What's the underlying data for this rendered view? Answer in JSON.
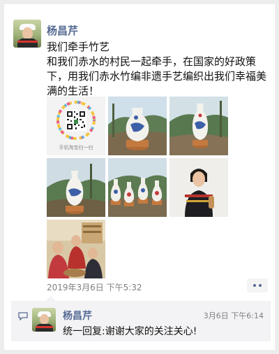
{
  "post": {
    "author": "杨昌芹",
    "text_line1": "我们牵手竹艺",
    "text_line2": "和我们赤水的村民一起牵手，在国家的好政策下，用我们赤水竹编非遗手艺编织出我们幸福美满的生活！",
    "timestamp": "2019年3月6日 下午5:32",
    "qr_caption": "手机淘宝扫一扫",
    "images": [
      "qr-code",
      "bamboo-vase",
      "bamboo-vase",
      "bamboo-vase",
      "bamboo-vase-group",
      "woman-with-vase",
      "people-working-with-bamboo"
    ]
  },
  "comments": [
    {
      "author": "杨昌芹",
      "time": "3月6日 下午6:14",
      "text": "统一回复:谢谢大家的关注关心!"
    }
  ],
  "colors": {
    "name_link": "#576b95",
    "timestamp": "#7f7f7f",
    "comment_bg": "#f3f3f5",
    "page_bg": "#ededed"
  }
}
